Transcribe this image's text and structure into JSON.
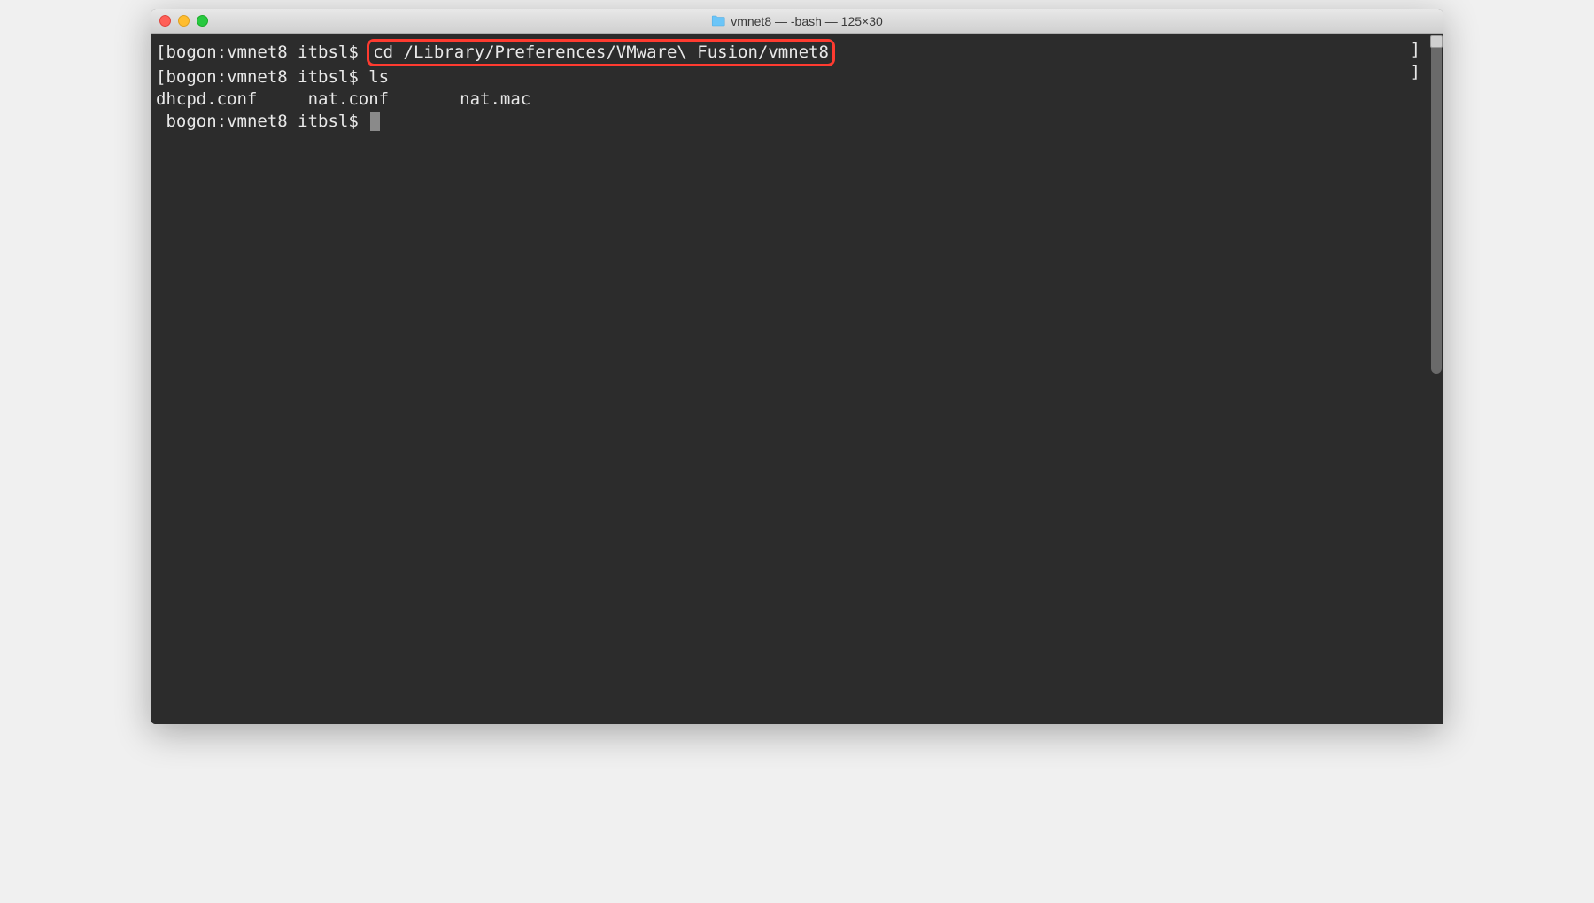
{
  "window": {
    "title": "vmnet8 — -bash — 125×30"
  },
  "terminal": {
    "line1": {
      "bracket": "[",
      "prompt": "bogon:vmnet8 itbsl$ ",
      "command": "cd /Library/Preferences/VMware\\ Fusion/vmnet8"
    },
    "line2": {
      "bracket": "[",
      "prompt": "bogon:vmnet8 itbsl$ ",
      "command": "ls"
    },
    "line3": {
      "output": "dhcpd.conf     nat.conf       nat.mac"
    },
    "line4": {
      "prompt": "bogon:vmnet8 itbsl$ "
    },
    "right_bracket_1": "]",
    "right_bracket_2": "]"
  }
}
